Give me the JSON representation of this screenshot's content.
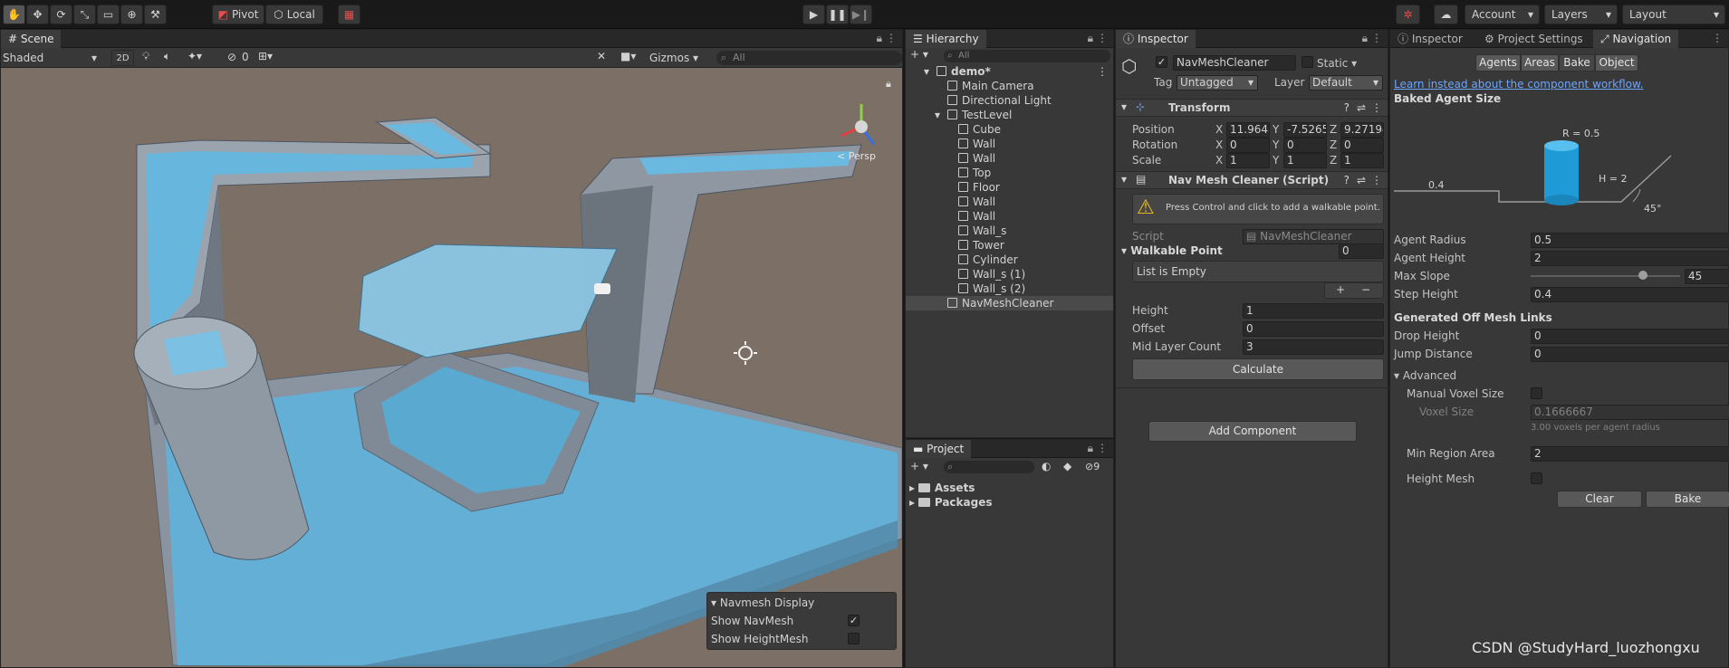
{
  "toolbar": {
    "pivot": "Pivot",
    "local": "Local",
    "account": "Account",
    "layers": "Layers",
    "layout": "Layout"
  },
  "scene": {
    "tab": "Scene",
    "shading": "Shaded",
    "mode2d": "2D",
    "gizmos": "Gizmos",
    "search_placeholder": "All",
    "persp": "Persp",
    "hidden_count": "0",
    "navmesh_display": {
      "title": "Navmesh Display",
      "show_navmesh": "Show NavMesh",
      "show_heightmesh": "Show HeightMesh"
    }
  },
  "hierarchy": {
    "tab": "Hierarchy",
    "search_placeholder": "All",
    "items": [
      "demo*",
      "Main Camera",
      "Directional Light",
      "TestLevel",
      "Cube",
      "Wall",
      "Wall",
      "Top",
      "Floor",
      "Wall",
      "Wall",
      "Wall_s",
      "Tower",
      "Cylinder",
      "Wall_s (1)",
      "Wall_s (2)",
      "NavMeshCleaner"
    ]
  },
  "project": {
    "tab": "Project",
    "hidden_count": "9",
    "items": [
      "Assets",
      "Packages"
    ]
  },
  "inspector": {
    "tab": "Inspector",
    "object_name": "NavMeshCleaner",
    "static": "Static",
    "tag_label": "Tag",
    "tag": "Untagged",
    "layer_label": "Layer",
    "layer": "Default",
    "transform": {
      "title": "Transform",
      "position": "Position",
      "rotation": "Rotation",
      "scale": "Scale",
      "pos": [
        "11.9648",
        "-7.5265",
        "9.27194"
      ],
      "rot": [
        "0",
        "0",
        "0"
      ],
      "scl": [
        "1",
        "1",
        "1"
      ]
    },
    "script_comp": {
      "title": "Nav Mesh Cleaner (Script)",
      "warning": "Press Control and click to add a walkable point.",
      "script_label": "Script",
      "script_value": "NavMeshCleaner",
      "walkable_point": "Walkable Point",
      "walkable_count": "0",
      "list_empty": "List is Empty",
      "height_label": "Height",
      "height": "1",
      "offset_label": "Offset",
      "offset": "0",
      "mid_label": "Mid Layer Count",
      "mid": "3",
      "calculate": "Calculate"
    },
    "add_component": "Add Component"
  },
  "navigation": {
    "tabs": [
      "Inspector",
      "Project Settings",
      "Navigation"
    ],
    "subtabs": [
      "Agents",
      "Areas",
      "Bake",
      "Object"
    ],
    "link": "Learn instead about the component workflow.",
    "baked_title": "Baked Agent Size",
    "diagram": {
      "r": "R = 0.5",
      "h": "H = 2",
      "step": "0.4",
      "angle": "45°"
    },
    "agent_radius_label": "Agent Radius",
    "agent_radius": "0.5",
    "agent_height_label": "Agent Height",
    "agent_height": "2",
    "max_slope_label": "Max Slope",
    "max_slope": "45",
    "max_slope_fraction": 0.75,
    "step_height_label": "Step Height",
    "step_height": "0.4",
    "offmesh_title": "Generated Off Mesh Links",
    "drop_label": "Drop Height",
    "drop": "0",
    "jump_label": "Jump Distance",
    "jump": "0",
    "advanced": "Advanced",
    "manual_voxel": "Manual Voxel Size",
    "voxel_size_label": "Voxel Size",
    "voxel_size": "0.1666667",
    "voxel_note": "3.00 voxels per agent radius",
    "min_region_label": "Min Region Area",
    "min_region": "2",
    "height_mesh": "Height Mesh",
    "clear": "Clear",
    "bake": "Bake"
  },
  "watermark": "CSDN @StudyHard_luozhongxu",
  "colors": {
    "navmesh": "#5aaed6",
    "sky": "#7d7068",
    "panel": "#383838"
  }
}
